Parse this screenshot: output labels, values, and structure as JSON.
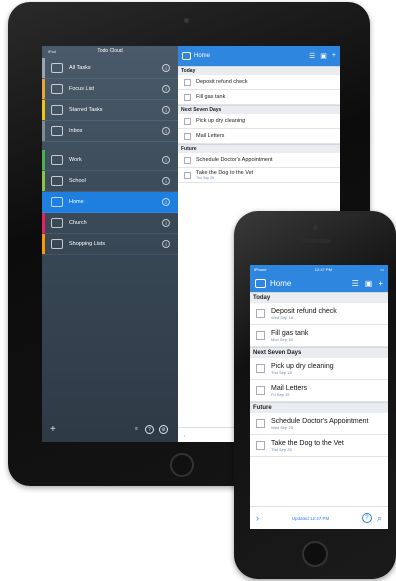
{
  "colors": {
    "accent": "#2e86de",
    "selected": "#1f7fe0"
  },
  "ipad": {
    "sidebar": {
      "title": "Todo Cloud",
      "status_left": "iPad",
      "items": [
        {
          "name": "All Tasks",
          "sub": "",
          "color": "#9aa5b1",
          "icon": "checkbox-icon"
        },
        {
          "name": "Focus List",
          "sub": "",
          "color": "#e8a53a",
          "icon": "focus-icon"
        },
        {
          "name": "Starred Tasks",
          "sub": "",
          "color": "#f1c40f",
          "icon": "star-icon"
        },
        {
          "name": "Inbox",
          "sub": "",
          "color": "#7f8c8d",
          "icon": "inbox-icon"
        },
        {
          "name": "Work",
          "sub": "",
          "color": "#4caf50",
          "icon": "briefcase-icon"
        },
        {
          "name": "School",
          "sub": "",
          "color": "#8bc34a",
          "icon": "book-icon"
        },
        {
          "name": "Home",
          "sub": "",
          "color": "#1f7fe0",
          "icon": "home-icon",
          "selected": true
        },
        {
          "name": "Church",
          "sub": "",
          "color": "#e91e63",
          "icon": "church-icon"
        },
        {
          "name": "Shopping Lists",
          "sub": "",
          "color": "#ff9800",
          "icon": "cart-icon"
        }
      ],
      "separator": ""
    },
    "main": {
      "title": "Home",
      "sections": [
        {
          "label": "Today",
          "tasks": [
            {
              "title": "Deposit refund check",
              "date": ""
            },
            {
              "title": "Fill gas tank",
              "date": ""
            }
          ]
        },
        {
          "label": "Next Seven Days",
          "tasks": [
            {
              "title": "Pick up dry cleaning",
              "date": ""
            },
            {
              "title": "Mail Letters",
              "date": ""
            }
          ]
        },
        {
          "label": "Future",
          "tasks": [
            {
              "title": "Schedule Doctor's Appointment",
              "date": ""
            },
            {
              "title": "Take the Dog to the Vet",
              "date": "Thu Sep 25"
            }
          ]
        }
      ],
      "footer_updated": "Updated"
    }
  },
  "iphone": {
    "status": {
      "carrier": "iPhone",
      "time": "12:47 PM"
    },
    "title": "Home",
    "sections": [
      {
        "label": "Today",
        "tasks": [
          {
            "title": "Deposit refund check",
            "date": "Wed Sep 18"
          },
          {
            "title": "Fill gas tank",
            "date": "Mon Sep 18"
          }
        ]
      },
      {
        "label": "Next Seven Days",
        "tasks": [
          {
            "title": "Pick up dry cleaning",
            "date": "Thu Sep 18"
          },
          {
            "title": "Mail Letters",
            "date": "Fri Sep 19"
          }
        ]
      },
      {
        "label": "Future",
        "tasks": [
          {
            "title": "Schedule Doctor's Appointment",
            "date": "Wed Sep 25"
          },
          {
            "title": "Take the Dog to the Vet",
            "date": "Thu Sep 25"
          }
        ]
      }
    ],
    "footer": {
      "updated": "Updated 12:47 PM",
      "sub": ""
    }
  }
}
